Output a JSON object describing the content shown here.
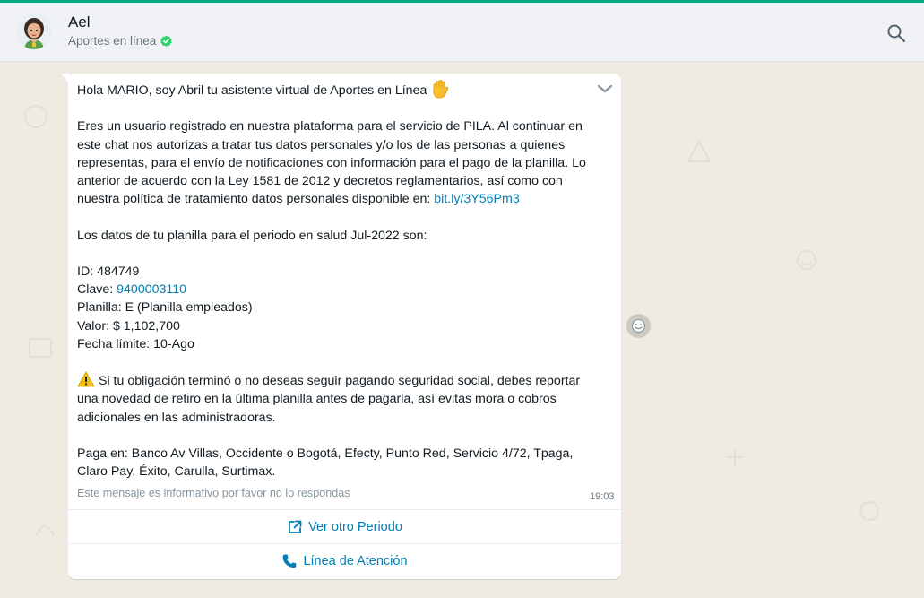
{
  "header": {
    "contact_name": "Ael",
    "contact_status": "Aportes en línea"
  },
  "message": {
    "greeting": "Hola MARIO, soy Abril tu asistente virtual de Aportes en Línea",
    "para1_line1": "Eres un usuario registrado en nuestra plataforma para el servicio de PILA. Al continuar en",
    "para1_line2": "este chat nos autorizas a tratar tus datos personales y/o los de las personas a quienes",
    "para1_line3": "representas, para el envío de notificaciones con información para el pago de la planilla. Lo",
    "para1_line4": "anterior de acuerdo con la Ley 1581 de 2012 y decretos reglamentarios, así como con",
    "para1_line5": "nuestra política de tratamiento datos personales disponible en: ",
    "policy_link": "bit.ly/3Y56Pm3",
    "period_line": "Los datos de tu planilla para el periodo en salud Jul-2022 son:",
    "id_line": "ID: 484749",
    "clave_label": "Clave: ",
    "clave_value": "9400003110",
    "planilla_line": "Planilla: E (Planilla empleados)",
    "valor_line": "Valor: $ 1,102,700",
    "fecha_line": "Fecha límite: 10-Ago",
    "warning_line1": "Si tu obligación terminó o no deseas seguir pagando seguridad social, debes reportar",
    "warning_line2": "una novedad de retiro en la última planilla antes de pagarla, así evitas mora o cobros",
    "warning_line3": "adicionales en las administradoras.",
    "paga_line1": "Paga en: Banco Av Villas, Occidente o Bogotá, Efecty, Punto Red, Servicio 4/72, Tpaga,",
    "paga_line2": "Claro Pay, Éxito, Carulla, Surtimax.",
    "footer": "Este mensaje es informativo por favor no lo respondas",
    "time": "19:03"
  },
  "actions": {
    "button1": "Ver otro Periodo",
    "button2": "Línea de Atención"
  },
  "colors": {
    "accent": "#00a884",
    "link": "#027eb5",
    "chat_bg": "#efeae2",
    "bubble": "#ffffff"
  },
  "icons": {
    "search": "search-icon",
    "verified": "verified-check-icon",
    "chevron": "chevron-down-icon",
    "wave": "raised-hand-icon",
    "warning": "warning-icon",
    "external": "external-link-icon",
    "phone": "phone-icon",
    "emoji": "emoji-smile-icon"
  }
}
